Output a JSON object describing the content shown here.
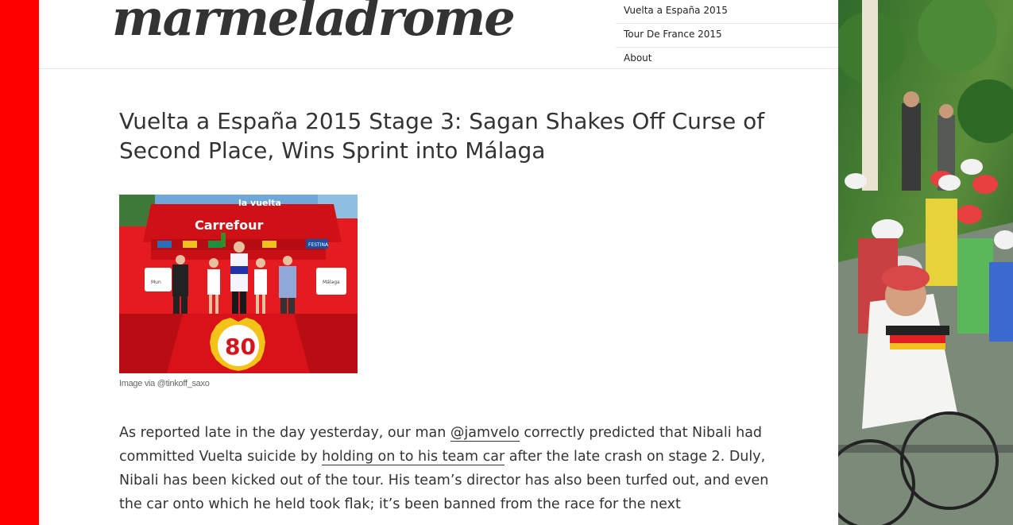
{
  "site": {
    "logo": "marmeladrome"
  },
  "nav": {
    "items": [
      {
        "label": "Vuelta a España 2015"
      },
      {
        "label": "Tour De France 2015"
      },
      {
        "label": "About"
      }
    ]
  },
  "post": {
    "title": "Vuelta a España 2015 Stage 3: Sagan Shakes Off Curse of Second Place, Wins Sprint into Málaga",
    "image_caption": "Image via @tinkoff_saxo",
    "podium_text": {
      "banner": "Carrefour",
      "brand": "la vuelta",
      "badge": "80",
      "left_sign": "Mun",
      "right_sign": "Málaga",
      "festina": "FESTINA"
    },
    "body": {
      "p1_a": "As reported late in the day yesterday, our man ",
      "link1": "@jamvelo",
      "p1_b": " correctly predicted that Nibali had committed Vuelta suicide by ",
      "link2": "holding on to his team car",
      "p1_c": " after the late crash on stage 2. Duly, Nibali has been kicked out of the tour. His team’s director has also been turfed out, and even the car onto which he held took flak; it’s been banned from the race for the next"
    }
  },
  "colors": {
    "left_bar": "#ff0000",
    "text": "#333333"
  }
}
